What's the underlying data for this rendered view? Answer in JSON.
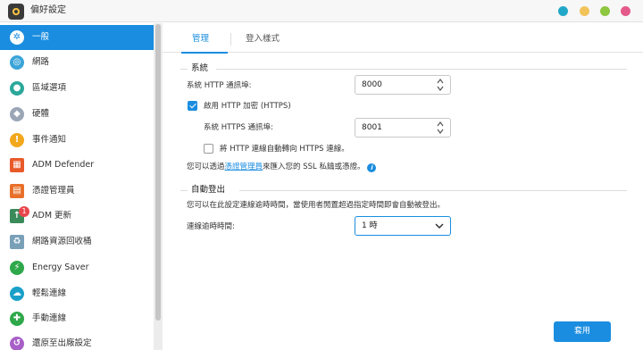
{
  "window": {
    "title": "偏好設定"
  },
  "sidebar": {
    "items": [
      {
        "label": "一般",
        "icon": "gear-icon",
        "color": "#1a8de0"
      },
      {
        "label": "網路",
        "icon": "globe-icon",
        "color": "#3aa4d8"
      },
      {
        "label": "區域選項",
        "icon": "location-icon",
        "color": "#2aa89a"
      },
      {
        "label": "硬體",
        "icon": "hardware-icon",
        "color": "#9aa6b6"
      },
      {
        "label": "事件通知",
        "icon": "alert-icon",
        "color": "#f2a81d"
      },
      {
        "label": "ADM Defender",
        "icon": "firewall-icon",
        "color": "#e85a2a"
      },
      {
        "label": "憑證管理員",
        "icon": "certificate-icon",
        "color": "#e8702a"
      },
      {
        "label": "ADM 更新",
        "icon": "update-icon",
        "color": "#3a8a5a",
        "badge": "1"
      },
      {
        "label": "網路資源回收桶",
        "icon": "recycle-bin-icon",
        "color": "#7aa0b8"
      },
      {
        "label": "Energy Saver",
        "icon": "leaf-icon",
        "color": "#2ea84a"
      },
      {
        "label": "輕鬆連線",
        "icon": "cloud-icon",
        "color": "#1aa0c8"
      },
      {
        "label": "手動連線",
        "icon": "connect-icon",
        "color": "#2ea84a"
      },
      {
        "label": "還原至出廠設定",
        "icon": "restore-icon",
        "color": "#a860c8"
      }
    ]
  },
  "tabs": [
    {
      "label": "管理"
    },
    {
      "label": "登入樣式"
    }
  ],
  "system": {
    "title": "系統",
    "http_port_label": "系統 HTTP 通訊埠:",
    "http_port_value": "8000",
    "https_checkbox_label": "啟用 HTTP 加密 (HTTPS)",
    "https_port_label": "系統 HTTPS 通訊埠:",
    "https_port_value": "8001",
    "redirect_label": "將 HTTP 連線自動轉向 HTTPS 連線。",
    "ssl_text_before": "您可以透過",
    "ssl_link": "憑證管理員",
    "ssl_text_after": "來匯入您的 SSL 私鑰或憑證。"
  },
  "auto_logout": {
    "title": "自動登出",
    "description": "您可以在此設定連線逾時時間，當使用者閒置超過指定時間即會自動被登出。",
    "timeout_label": "連線逾時時間:",
    "timeout_value": "1 時"
  },
  "apply_button": "套用",
  "colors": {
    "accent": "#1a8de0",
    "badge": "#e8474d"
  }
}
